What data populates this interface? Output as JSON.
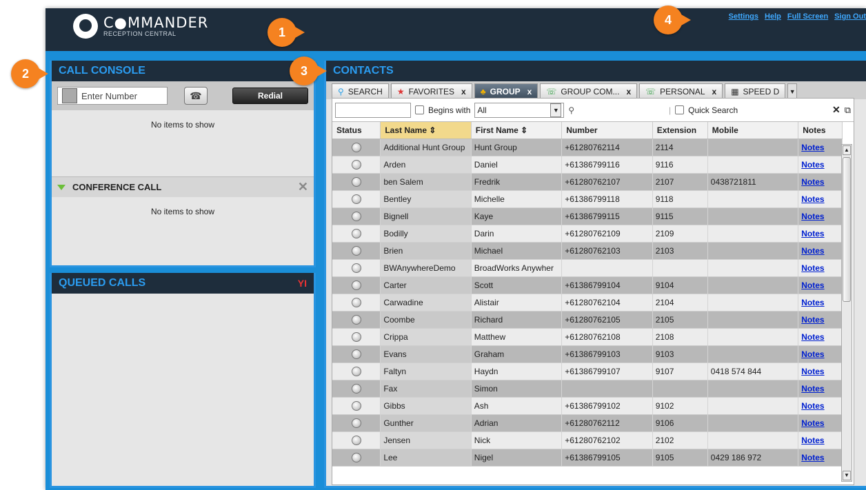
{
  "header": {
    "brand_title": "C●MMANDER",
    "brand_subtitle": "RECEPTION CENTRAL",
    "links": [
      "Settings",
      "Help",
      "Full Screen",
      "Sign Out"
    ]
  },
  "call_console": {
    "title": "CALL CONSOLE",
    "number_placeholder": "Enter Number",
    "redial_label": "Redial",
    "empty_text": "No items to show"
  },
  "conference": {
    "title": "CONFERENCE CALL",
    "empty_text": "No items to show"
  },
  "queued": {
    "title": "QUEUED CALLS"
  },
  "contacts": {
    "title": "CONTACTS",
    "tabs": [
      {
        "label": "SEARCH",
        "closable": false
      },
      {
        "label": "FAVORITES",
        "closable": true
      },
      {
        "label": "GROUP",
        "closable": true,
        "active": true
      },
      {
        "label": "GROUP COM...",
        "closable": true
      },
      {
        "label": "PERSONAL",
        "closable": true
      },
      {
        "label": "SPEED D",
        "closable": false
      }
    ],
    "filter": {
      "begins_with_label": "Begins with",
      "select_value": "All",
      "quick_search_label": "Quick Search"
    },
    "columns": [
      "Status",
      "Last Name",
      "First Name",
      "Number",
      "Extension",
      "Mobile",
      "Notes"
    ],
    "rows": [
      [
        "Additional Hunt Group",
        "Hunt Group",
        "+61280762114",
        "2114",
        "",
        "Notes"
      ],
      [
        "Arden",
        "Daniel",
        "+61386799116",
        "9116",
        "",
        "Notes"
      ],
      [
        "ben Salem",
        "Fredrik",
        "+61280762107",
        "2107",
        "0438721811",
        "Notes"
      ],
      [
        "Bentley",
        "Michelle",
        "+61386799118",
        "9118",
        "",
        "Notes"
      ],
      [
        "Bignell",
        "Kaye",
        "+61386799115",
        "9115",
        "",
        "Notes"
      ],
      [
        "Bodilly",
        "Darin",
        "+61280762109",
        "2109",
        "",
        "Notes"
      ],
      [
        "Brien",
        "Michael",
        "+61280762103",
        "2103",
        "",
        "Notes"
      ],
      [
        "BWAnywhereDemo",
        "BroadWorks Anywher",
        "",
        "",
        "",
        "Notes"
      ],
      [
        "Carter",
        "Scott",
        "+61386799104",
        "9104",
        "",
        "Notes"
      ],
      [
        "Carwadine",
        "Alistair",
        "+61280762104",
        "2104",
        "",
        "Notes"
      ],
      [
        "Coombe",
        "Richard",
        "+61280762105",
        "2105",
        "",
        "Notes"
      ],
      [
        "Crippa",
        "Matthew",
        "+61280762108",
        "2108",
        "",
        "Notes"
      ],
      [
        "Evans",
        "Graham",
        "+61386799103",
        "9103",
        "",
        "Notes"
      ],
      [
        "Faltyn",
        "Haydn",
        "+61386799107",
        "9107",
        "0418 574 844",
        "Notes"
      ],
      [
        "Fax",
        "Simon",
        "",
        "",
        "",
        "Notes"
      ],
      [
        "Gibbs",
        "Ash",
        "+61386799102",
        "9102",
        "",
        "Notes"
      ],
      [
        "Gunther",
        "Adrian",
        "+61280762112",
        "9106",
        "",
        "Notes"
      ],
      [
        "Jensen",
        "Nick",
        "+61280762102",
        "2102",
        "",
        "Notes"
      ],
      [
        "Lee",
        "Nigel",
        "+61386799105",
        "9105",
        "0429 186 972",
        "Notes"
      ]
    ]
  },
  "callouts": [
    "1",
    "2",
    "3",
    "4"
  ],
  "colors": {
    "accent": "#1a8ed8",
    "header_bg": "#1e2d3c",
    "callout": "#f58220"
  }
}
